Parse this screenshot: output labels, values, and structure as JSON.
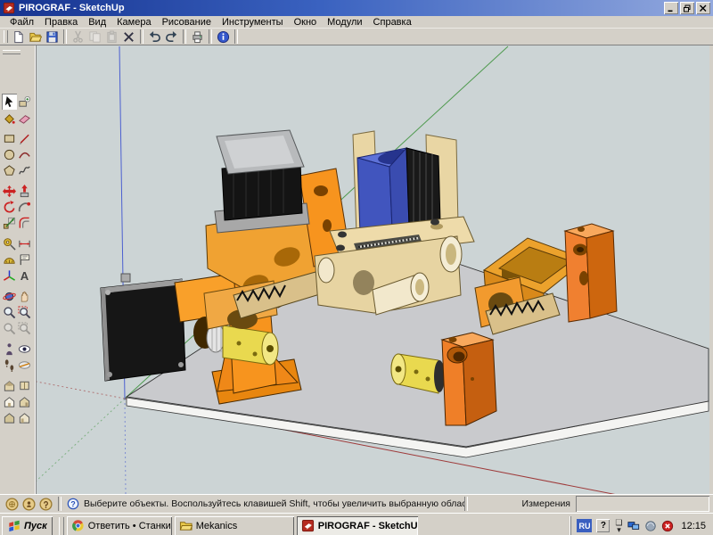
{
  "window": {
    "title": "PIROGRAF - SketchUp",
    "controls": [
      "minimize",
      "restore",
      "close"
    ]
  },
  "menubar": {
    "items": [
      "Файл",
      "Правка",
      "Вид",
      "Камера",
      "Рисование",
      "Инструменты",
      "Окно",
      "Модули",
      "Справка"
    ]
  },
  "toolbar": {
    "icons": [
      "new",
      "open",
      "save",
      "cut",
      "copy",
      "paste",
      "erase",
      "undo",
      "redo",
      "print",
      "model-info"
    ],
    "disabled_icons": [
      "cut",
      "copy",
      "paste"
    ]
  },
  "palette": {
    "tools": [
      "select",
      "make-component",
      "paint-bucket",
      "eraser",
      "rectangle",
      "line",
      "circle",
      "arc",
      "polygon",
      "freehand",
      "move",
      "push-pull",
      "rotate",
      "follow-me",
      "scale",
      "offset",
      "tape-measure",
      "dimension",
      "protractor",
      "text",
      "axes",
      "3d-text",
      "orbit",
      "pan",
      "zoom",
      "zoom-window",
      "zoom-previous",
      "zoom-next",
      "position-camera",
      "look-around",
      "walk",
      "section-plane",
      "view-iso",
      "view-top",
      "view-front",
      "view-right",
      "view-back",
      "view-left"
    ],
    "active_tool": "select",
    "disabled_tools": [
      "zoom-previous",
      "zoom-next"
    ]
  },
  "viewport": {
    "axes_colors": {
      "red": "#9e3a3a",
      "green": "#4f9a4f",
      "blue": "#4b5fd0"
    },
    "model_colors": {
      "base_plate": "#c9cacd",
      "plate_edge": "#f4f4f2",
      "orange_bright": "#f7941e",
      "orange_block": "#ef7f28",
      "golden": "#f0a232",
      "cream": "#e9d6a4",
      "tan_rail": "#d9c08a",
      "blue_box": "#4155be",
      "yellow_coupler": "#e9d94f",
      "motor_black": "#161616",
      "motor_silver": "#b3b3b3"
    },
    "model_parts": [
      "left-stepper-motor",
      "left-motor-bracket",
      "left-coupler",
      "center-stepper-motor",
      "center-carriage",
      "blue-heatsink-box",
      "lead-screw-platform",
      "rail-carriage",
      "right-frame-mount",
      "right-bearing-block",
      "front-right-bearing-block",
      "front-right-coupler"
    ]
  },
  "statusbar": {
    "status_icons": [
      "geolocation",
      "credits",
      "sign-in"
    ],
    "help_glyph": "?",
    "hint": "Выберите объекты. Воспользуйтесь клавишей Shift, чтобы увеличить выбранную область. Г",
    "measurements_label": "Измерения",
    "measurements_value": ""
  },
  "taskbar": {
    "start_label": "Пуск",
    "tasks": [
      {
        "icon": "chrome",
        "label": "Ответить • Станки с Ч...",
        "active": false
      },
      {
        "icon": "folder",
        "label": "Mekanics",
        "active": false
      },
      {
        "icon": "sketchup",
        "label": "PIROGRAF - SketchUp",
        "active": true
      }
    ],
    "tray": {
      "language": "RU",
      "help_glyph": "?",
      "icons": [
        "tray-help",
        "hidden-icons",
        "display-settings",
        "agent",
        "security-alert"
      ],
      "clock": "12:15"
    }
  }
}
